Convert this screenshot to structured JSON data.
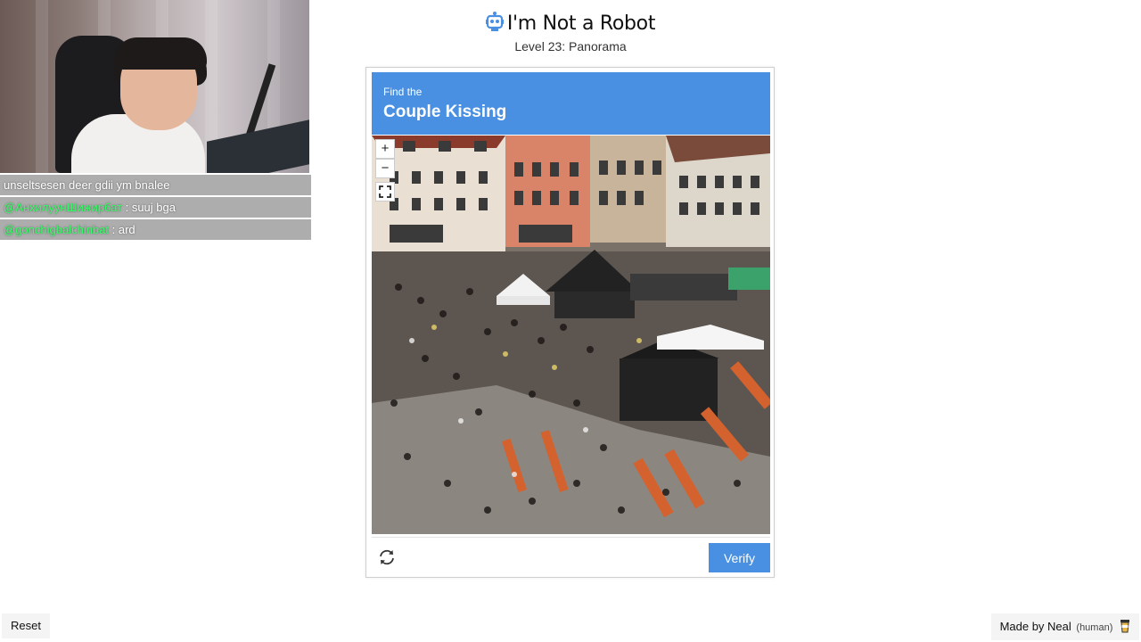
{
  "stream_overlay": {
    "chat": [
      {
        "user": "",
        "message": "unseltsesen deer gdii ym bnalee"
      },
      {
        "user": "@АнхилуунШижирбат",
        "message": " : suuj bga"
      },
      {
        "user": "@gonchigbalchinbat",
        "message": " : ard"
      }
    ]
  },
  "header": {
    "title": "I'm Not a Robot",
    "title_icon": "robot-icon",
    "level": "Level 23: Panorama"
  },
  "captcha": {
    "prompt_prefix": "Find the",
    "prompt_target": "Couple Kissing",
    "zoom_in_label": "+",
    "zoom_out_label": "−",
    "verify_label": "Verify",
    "accent_color": "#4a90e2"
  },
  "footer": {
    "reset_label": "Reset",
    "credit_label": "Made by Neal",
    "credit_note": "(human)"
  }
}
